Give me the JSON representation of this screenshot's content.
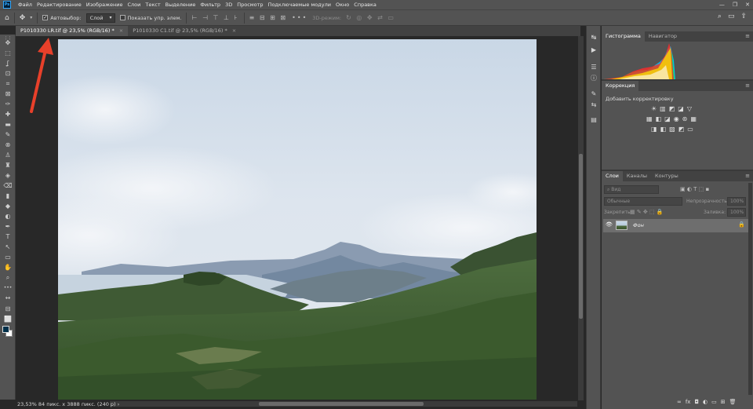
{
  "menubar": {
    "logo": "Ps",
    "items": [
      "Файл",
      "Редактирование",
      "Изображение",
      "Слои",
      "Текст",
      "Выделение",
      "Фильтр",
      "3D",
      "Просмотр",
      "Подключаемые модули",
      "Окно",
      "Справка"
    ],
    "win_minimize": "—",
    "win_maximize": "❐",
    "win_close": "✕"
  },
  "optbar": {
    "home_icon": "⌂",
    "move_icon": "✥",
    "autoselect_label": "Автовыбор:",
    "autoselect_checked": "✓",
    "autoselect_value": "Слой",
    "show_transform_label": "Показать упр. элем.",
    "align_icons_1": "⊢ ⊣ ⊤ ⊥ ⊦",
    "align_icons_2": "≡ ⊟ ⊞ ⊠",
    "more": "•••",
    "mode3d_label": "3D-режим:",
    "mode3d_icons": "↻ ◎ ✥ ⇄ ▭",
    "search_icon": "⌕",
    "workspace_icon": "▭",
    "share_icon": "⇪"
  },
  "tabs": [
    {
      "label": "P1010330 LR.tif @ 23,5% (RGB/16) *",
      "close": "×",
      "active": true
    },
    {
      "label": "P1010330 C1.tif @ 23,5% (RGB/16) *",
      "close": "×",
      "active": false
    }
  ],
  "toolbar": {
    "tools": [
      "⋮⋮",
      "✥",
      "⬚",
      "ʆ",
      "⊡",
      "⌗",
      "⊠",
      "✑",
      "✚",
      "▬",
      "✎",
      "⊗",
      "♙",
      "♜",
      "◈",
      "⌫",
      "▮",
      "◆",
      "◐",
      "✒",
      "T",
      "↖",
      "▭",
      "✋",
      "⌕",
      "•••",
      "↔",
      "⊟",
      "⬜"
    ],
    "fg_color": "#00304a",
    "bg_color": "#ffffff"
  },
  "status": {
    "text": "23,53%  84 пикс. x 3888 пикс. (240 p)",
    "arrow": "›"
  },
  "iconstrip": {
    "icons": [
      "↹",
      "▶",
      "☰",
      "ⓘ",
      "✎",
      "⇆",
      "▤",
      "⊠",
      "♟"
    ]
  },
  "panels": {
    "histogram_tab": "Гистограмма",
    "navigator_tab": "Навигатор",
    "panel_menu": "≡",
    "corrections_tab": "Коррекция",
    "add_adjustment": "Добавить корректировку",
    "adj_row1": [
      "☀",
      "▥",
      "◩",
      "◪",
      "▽"
    ],
    "adj_row2": [
      "▦",
      "◧",
      "◪",
      "◉",
      "⊛",
      "▦"
    ],
    "adj_row3": [
      "◨",
      "◧",
      "▨",
      "◩",
      "▭"
    ],
    "layers_tabs": [
      "Слои",
      "Каналы",
      "Контуры"
    ],
    "kind_placeholder": "⌕ Вид",
    "kind_icons": "▣ ◐ T ⬚ ▪",
    "blend_mode": "Обычные",
    "opacity_label": "Непрозрачность:",
    "opacity_value": "100%",
    "lock_label": "Закрепить:",
    "lock_icons": "▦ ✎ ✥ ⬚ 🔒",
    "fill_label": "Заливка:",
    "fill_value": "100%",
    "layer_eye": "👁",
    "layer_name": "Фон",
    "layer_lock": "🔒",
    "footer_icons": [
      "∞",
      "fx",
      "◘",
      "◐",
      "▭",
      "⊞",
      "🗑"
    ]
  }
}
